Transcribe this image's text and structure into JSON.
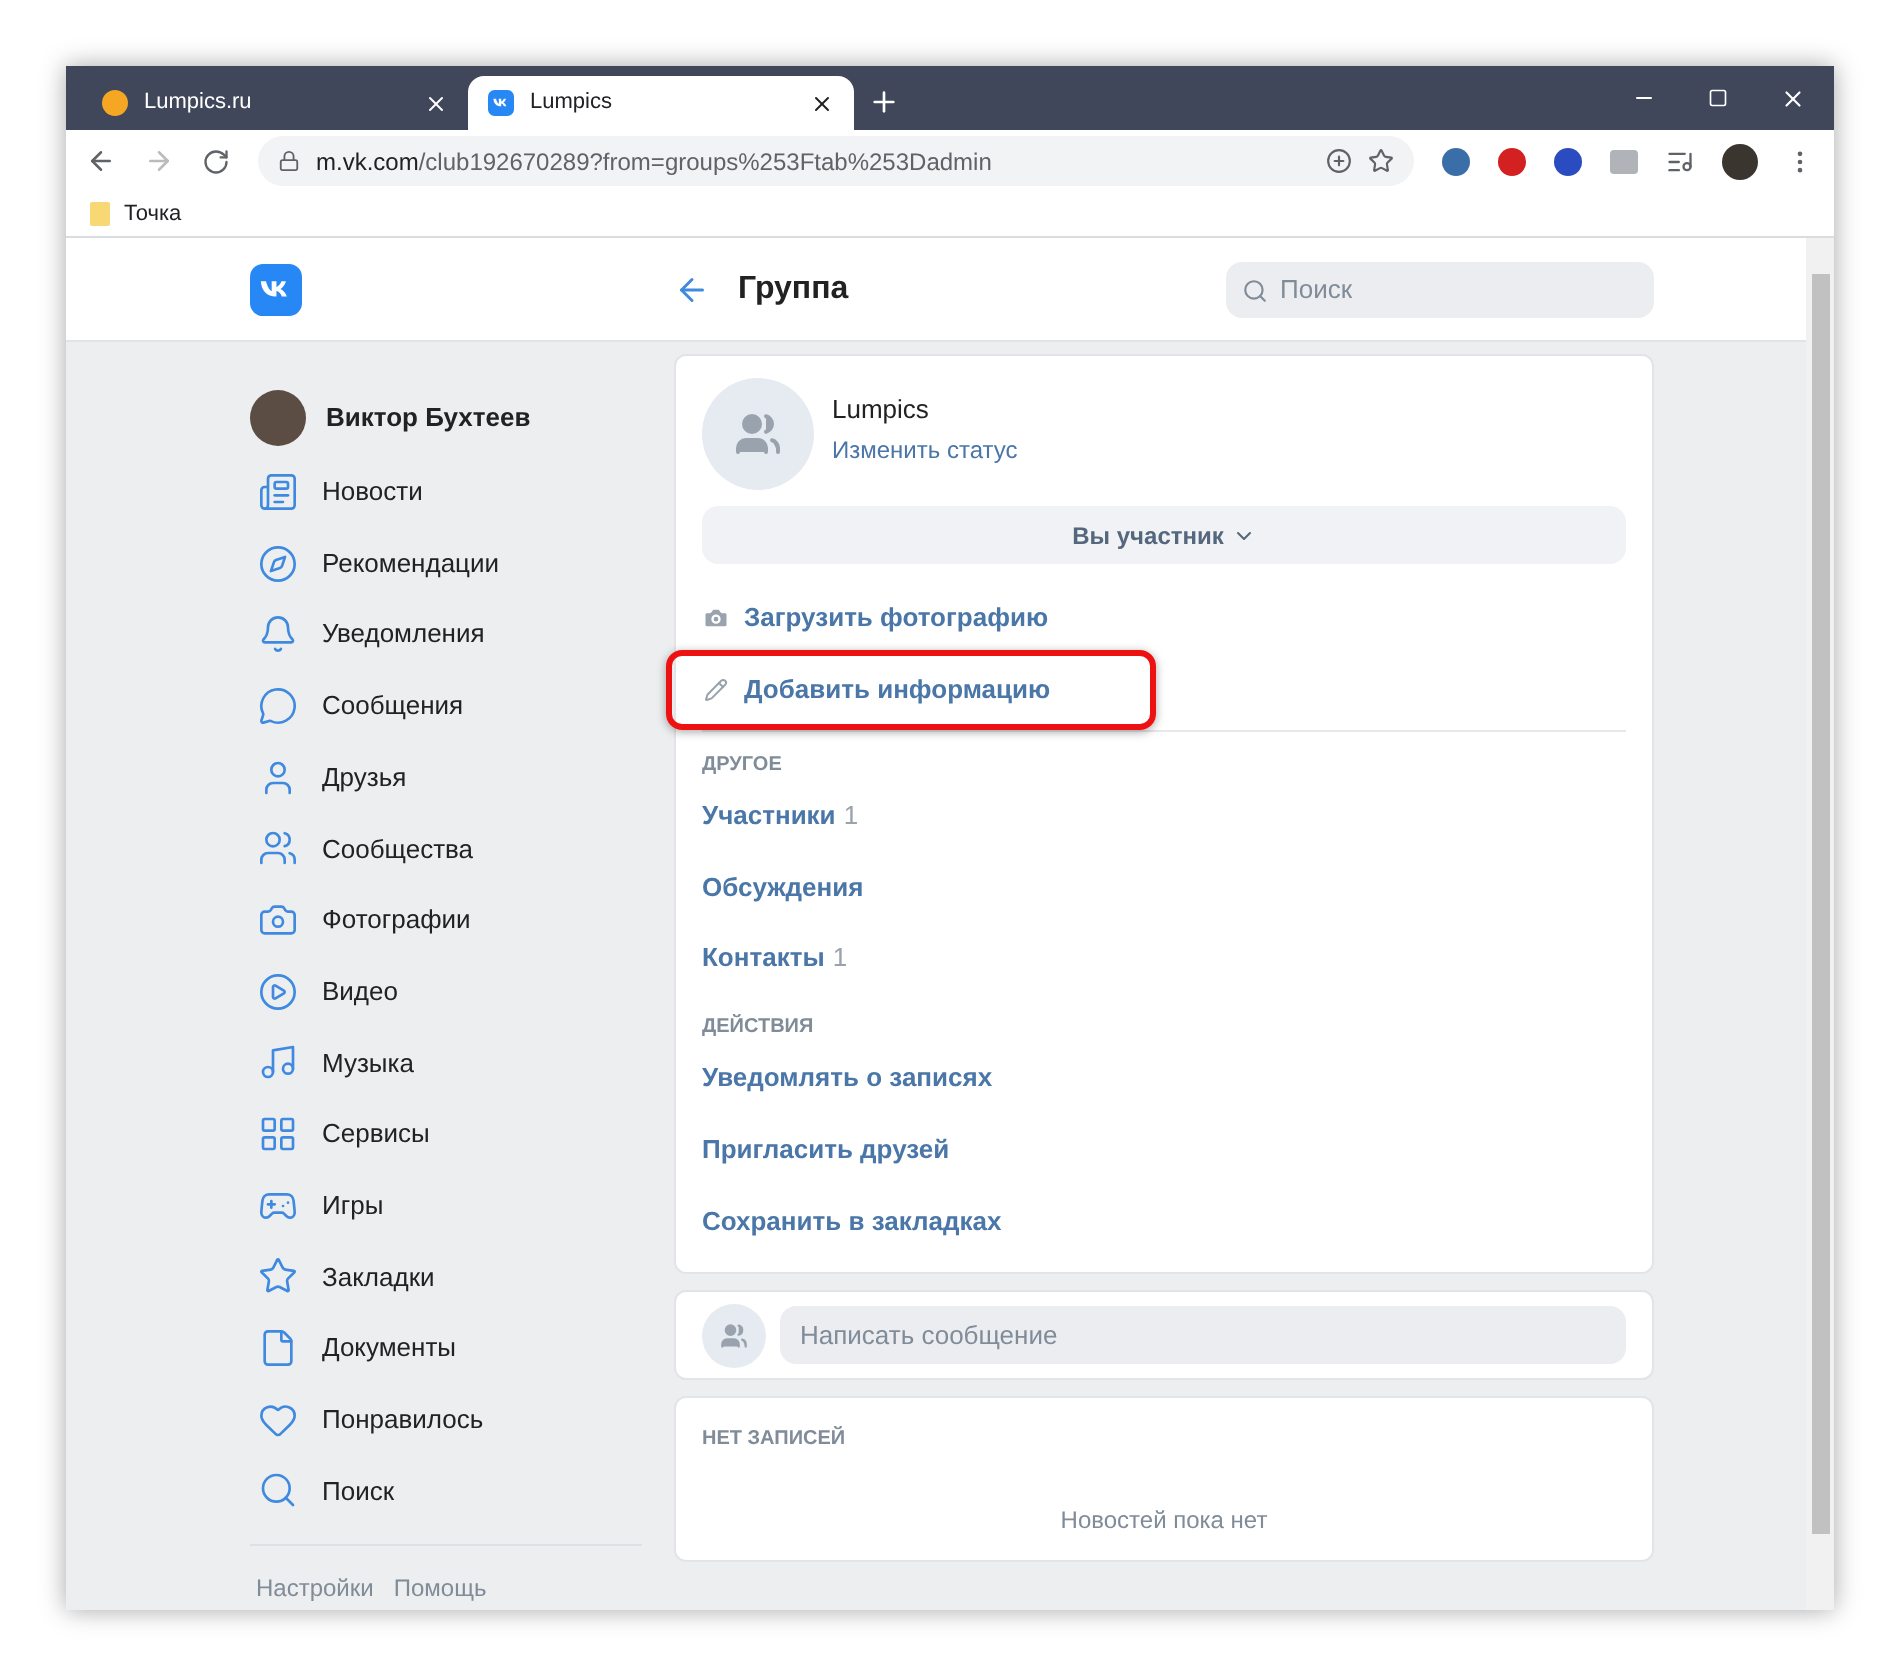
{
  "browser": {
    "tabs": [
      {
        "title": "Lumpics.ru",
        "selected": false,
        "kind": "circle"
      },
      {
        "title": "Lumpics",
        "selected": true,
        "kind": "vk"
      }
    ],
    "url_host": "m.vk.com",
    "url_path": "/club192670289?from=groups%253Ftab%253Dadmin",
    "bookmarks": [
      {
        "label": "Точка"
      }
    ]
  },
  "header": {
    "title": "Группа",
    "search": {
      "placeholder": "Поиск"
    }
  },
  "sidebar": {
    "profile": {
      "name": "Виктор Бухтеев"
    },
    "items": [
      {
        "label": "Новости"
      },
      {
        "label": "Рекомендации"
      },
      {
        "label": "Уведомления"
      },
      {
        "label": "Сообщения"
      },
      {
        "label": "Друзья"
      },
      {
        "label": "Сообщества"
      },
      {
        "label": "Фотографии"
      },
      {
        "label": "Видео"
      },
      {
        "label": "Музыка"
      },
      {
        "label": "Сервисы"
      },
      {
        "label": "Игры"
      },
      {
        "label": "Закладки"
      },
      {
        "label": "Документы"
      },
      {
        "label": "Понравилось"
      },
      {
        "label": "Поиск"
      }
    ],
    "footer_links": [
      "Настройки",
      "Помощь"
    ]
  },
  "group": {
    "name": "Lumpics",
    "status_link": "Изменить статус",
    "member_button": "Вы участник",
    "actions": [
      {
        "label": "Загрузить фотографию",
        "highlighted": false
      },
      {
        "label": "Добавить информацию",
        "highlighted": true
      }
    ],
    "sections": [
      {
        "heading": "ДРУГОЕ",
        "items": [
          {
            "label": "Участники",
            "count": "1"
          },
          {
            "label": "Обсуждения"
          },
          {
            "label": "Контакты",
            "count": "1"
          }
        ]
      },
      {
        "heading": "ДЕЙСТВИЯ",
        "items": [
          {
            "label": "Уведомлять о записях"
          },
          {
            "label": "Пригласить друзей"
          },
          {
            "label": "Сохранить в закладках"
          }
        ]
      }
    ]
  },
  "composer": {
    "placeholder": "Написать сообщение"
  },
  "wall": {
    "heading": "НЕТ ЗАПИСЕЙ",
    "empty_text": "Новостей пока нет"
  }
}
